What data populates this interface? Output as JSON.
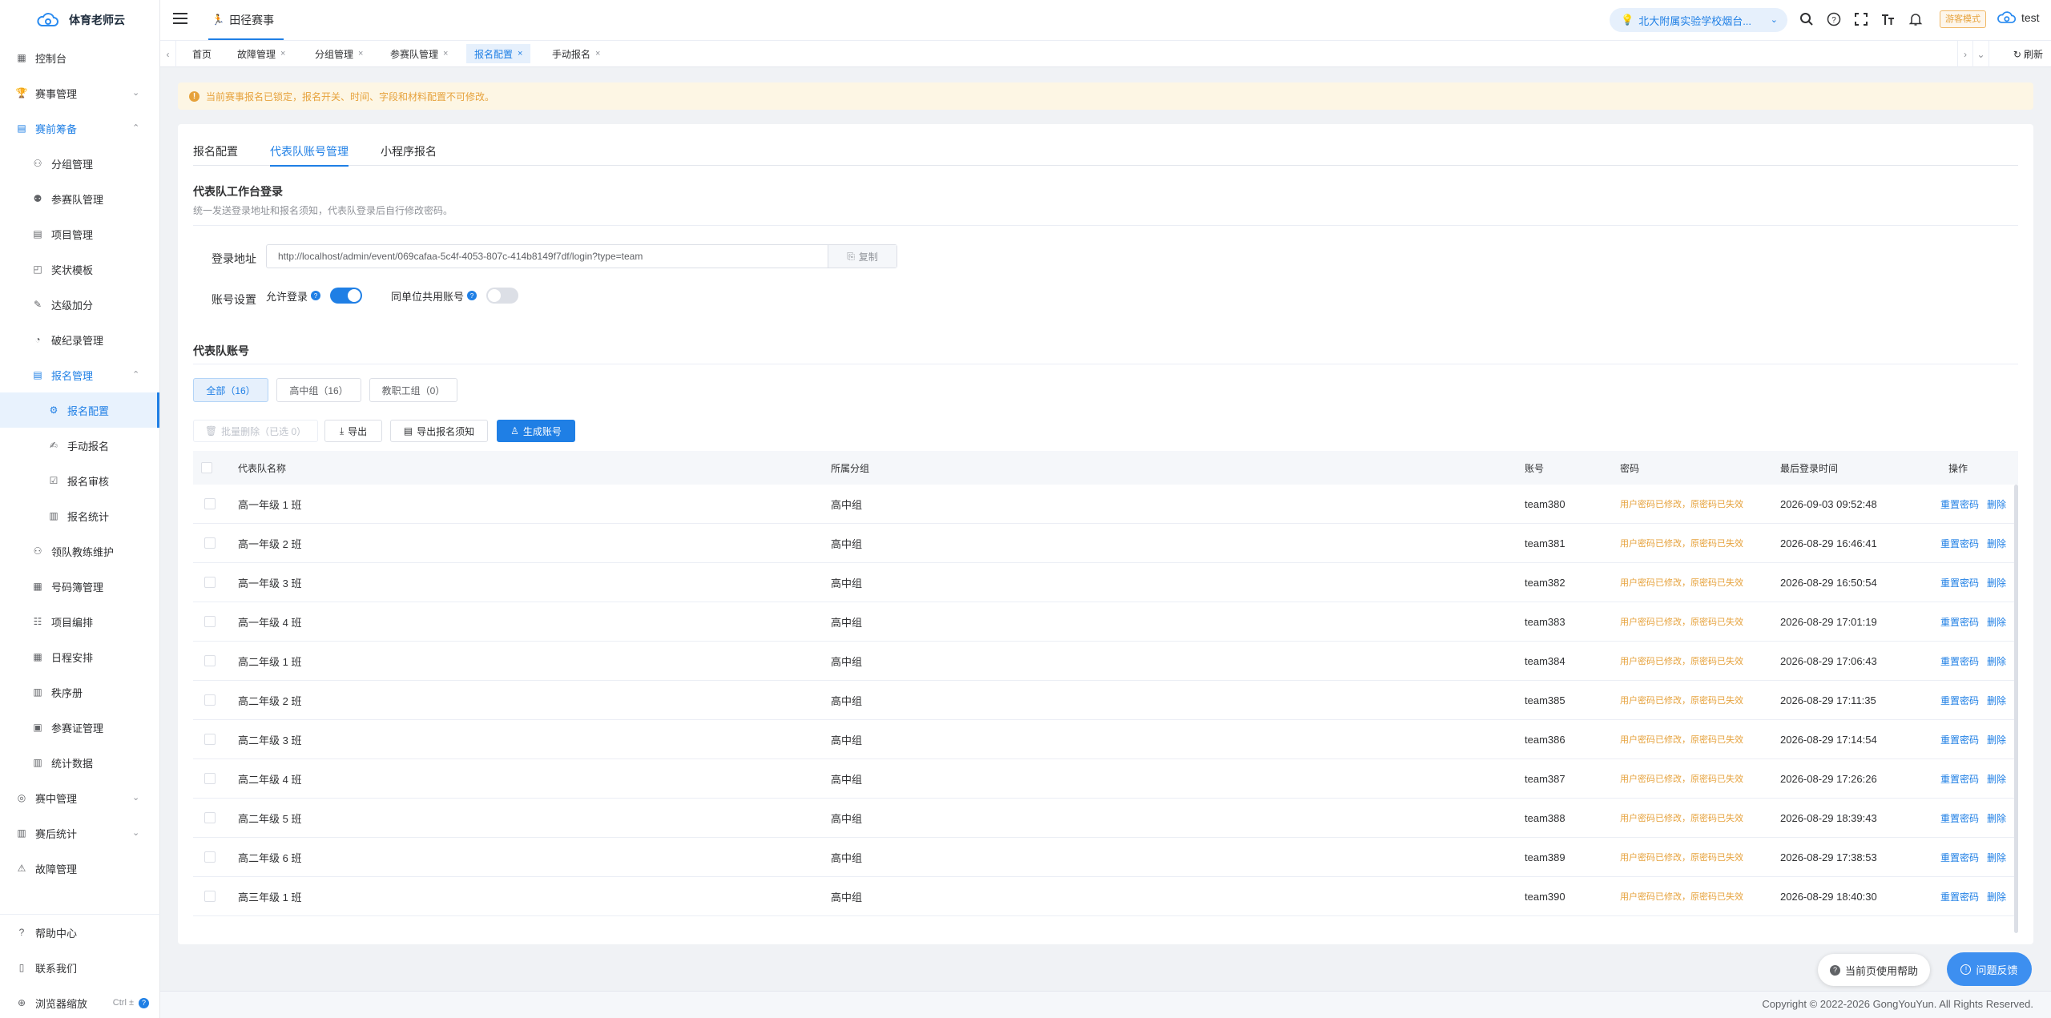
{
  "app": {
    "name": "体育老师云"
  },
  "sidebar": {
    "items": [
      {
        "label": "控制台",
        "icon": "dashboard-icon"
      },
      {
        "label": "赛事管理",
        "icon": "trophy-icon"
      },
      {
        "label": "赛前筹备",
        "icon": "clipboard-icon"
      },
      {
        "label": "分组管理",
        "icon": "group-icon"
      },
      {
        "label": "参赛队管理",
        "icon": "team-icon"
      },
      {
        "label": "项目管理",
        "icon": "document-icon"
      },
      {
        "label": "奖状模板",
        "icon": "certificate-icon"
      },
      {
        "label": "达级加分",
        "icon": "edit-icon"
      },
      {
        "label": "破纪录管理",
        "icon": "record-icon"
      },
      {
        "label": "报名管理",
        "icon": "register-icon"
      },
      {
        "label": "报名配置",
        "icon": "config-icon"
      },
      {
        "label": "手动报名",
        "icon": "manual-icon"
      },
      {
        "label": "报名审核",
        "icon": "audit-icon"
      },
      {
        "label": "报名统计",
        "icon": "stats-icon"
      },
      {
        "label": "领队教练维护",
        "icon": "coach-icon"
      },
      {
        "label": "号码簿管理",
        "icon": "number-icon"
      },
      {
        "label": "项目编排",
        "icon": "arrange-icon"
      },
      {
        "label": "日程安排",
        "icon": "calendar-icon"
      },
      {
        "label": "秩序册",
        "icon": "book-icon"
      },
      {
        "label": "参赛证管理",
        "icon": "badge-icon"
      },
      {
        "label": "统计数据",
        "icon": "chart-icon"
      },
      {
        "label": "赛中管理",
        "icon": "live-icon"
      },
      {
        "label": "赛后统计",
        "icon": "report-icon"
      },
      {
        "label": "故障管理",
        "icon": "fault-icon"
      }
    ],
    "bottom": [
      {
        "label": "帮助中心",
        "icon": "help-icon"
      },
      {
        "label": "联系我们",
        "icon": "phone-icon"
      },
      {
        "label": "浏览器缩放",
        "icon": "zoom-icon",
        "shortcut": "Ctrl ±"
      }
    ]
  },
  "header": {
    "tab": "田径赛事",
    "school": "北大附属实验学校烟台...",
    "guest_mode": "游客模式",
    "user": "test"
  },
  "tags": [
    {
      "label": "首页",
      "closable": false
    },
    {
      "label": "故障管理",
      "closable": true
    },
    {
      "label": "分组管理",
      "closable": true
    },
    {
      "label": "参赛队管理",
      "closable": true
    },
    {
      "label": "报名配置",
      "closable": true
    },
    {
      "label": "手动报名",
      "closable": true
    }
  ],
  "refresh": "刷新",
  "notice": "当前赛事报名已锁定，报名开关、时间、字段和材料配置不可修改。",
  "tabs": [
    "报名配置",
    "代表队账号管理",
    "小程序报名"
  ],
  "login": {
    "title": "代表队工作台登录",
    "subtitle": "统一发送登录地址和报名须知，代表队登录后自行修改密码。",
    "url_label": "登录地址",
    "url": "http://localhost/admin/event/069cafaa-5c4f-4053-807c-414b8149f7df/login?type=team",
    "copy": "复制",
    "settings_label": "账号设置",
    "allow_login": "允许登录",
    "share_account": "同单位共用账号"
  },
  "accounts": {
    "title": "代表队账号",
    "filters": [
      "全部（16）",
      "高中组（16）",
      "教职工组（0）"
    ],
    "buttons": {
      "batch_delete": "批量删除（已选 0）",
      "export": "导出",
      "export_notice": "导出报名须知",
      "generate": "生成账号"
    },
    "columns": [
      "代表队名称",
      "所属分组",
      "账号",
      "密码",
      "最后登录时间",
      "操作"
    ],
    "rows": [
      {
        "name": "高一年级 1 班",
        "group": "高中组",
        "account": "team380",
        "password": "用户密码已修改，原密码已失效",
        "last_login": "2026-09-03 09:52:48"
      },
      {
        "name": "高一年级 2 班",
        "group": "高中组",
        "account": "team381",
        "password": "用户密码已修改，原密码已失效",
        "last_login": "2026-08-29 16:46:41"
      },
      {
        "name": "高一年级 3 班",
        "group": "高中组",
        "account": "team382",
        "password": "用户密码已修改，原密码已失效",
        "last_login": "2026-08-29 16:50:54"
      },
      {
        "name": "高一年级 4 班",
        "group": "高中组",
        "account": "team383",
        "password": "用户密码已修改，原密码已失效",
        "last_login": "2026-08-29 17:01:19"
      },
      {
        "name": "高二年级 1 班",
        "group": "高中组",
        "account": "team384",
        "password": "用户密码已修改，原密码已失效",
        "last_login": "2026-08-29 17:06:43"
      },
      {
        "name": "高二年级 2 班",
        "group": "高中组",
        "account": "team385",
        "password": "用户密码已修改，原密码已失效",
        "last_login": "2026-08-29 17:11:35"
      },
      {
        "name": "高二年级 3 班",
        "group": "高中组",
        "account": "team386",
        "password": "用户密码已修改，原密码已失效",
        "last_login": "2026-08-29 17:14:54"
      },
      {
        "name": "高二年级 4 班",
        "group": "高中组",
        "account": "team387",
        "password": "用户密码已修改，原密码已失效",
        "last_login": "2026-08-29 17:26:26"
      },
      {
        "name": "高二年级 5 班",
        "group": "高中组",
        "account": "team388",
        "password": "用户密码已修改，原密码已失效",
        "last_login": "2026-08-29 18:39:43"
      },
      {
        "name": "高二年级 6 班",
        "group": "高中组",
        "account": "team389",
        "password": "用户密码已修改，原密码已失效",
        "last_login": "2026-08-29 17:38:53"
      },
      {
        "name": "高三年级 1 班",
        "group": "高中组",
        "account": "team390",
        "password": "用户密码已修改，原密码已失效",
        "last_login": "2026-08-29 18:40:30"
      }
    ],
    "actions": [
      "重置密码",
      "删除"
    ]
  },
  "help": "当前页使用帮助",
  "feedback": "问题反馈",
  "footer": "Copyright © 2022-2026 GongYouYun. All Rights Reserved.",
  "colors": {
    "primary": "#1f7fe5",
    "warning": "#e6a23c"
  }
}
